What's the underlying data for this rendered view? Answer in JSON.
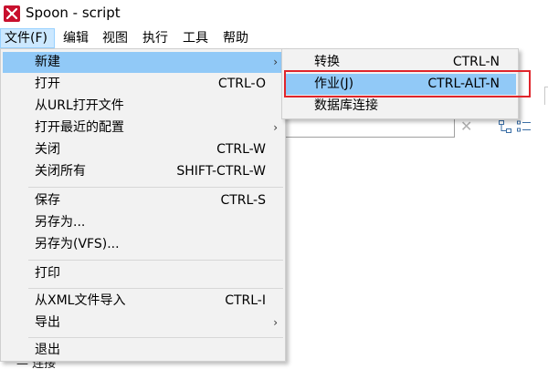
{
  "window": {
    "title": "Spoon - script"
  },
  "menubar": {
    "items": [
      {
        "label": "文件(F)",
        "active": true
      },
      {
        "label": "编辑"
      },
      {
        "label": "视图"
      },
      {
        "label": "执行"
      },
      {
        "label": "工具"
      },
      {
        "label": "帮助"
      }
    ]
  },
  "file_menu": {
    "items": [
      {
        "label": "新建",
        "shortcut": "",
        "submenu": true,
        "highlighted": true
      },
      {
        "label": "打开",
        "shortcut": "CTRL-O"
      },
      {
        "label": "从URL打开文件",
        "shortcut": ""
      },
      {
        "label": "打开最近的配置",
        "shortcut": "",
        "submenu": true
      },
      {
        "label": "关闭",
        "shortcut": "CTRL-W"
      },
      {
        "label": "关闭所有",
        "shortcut": "SHIFT-CTRL-W"
      },
      {
        "label": "保存",
        "shortcut": "CTRL-S"
      },
      {
        "label": "另存为...",
        "shortcut": ""
      },
      {
        "label": "另存为(VFS)...",
        "shortcut": ""
      },
      {
        "label": "打印",
        "shortcut": ""
      },
      {
        "label": "从XML文件导入",
        "shortcut": "CTRL-I"
      },
      {
        "label": "导出",
        "shortcut": "",
        "submenu": true
      },
      {
        "label": "退出",
        "shortcut": ""
      }
    ],
    "submenu_arrow": "›"
  },
  "new_submenu": {
    "items": [
      {
        "label": "转换",
        "shortcut": "CTRL-N"
      },
      {
        "label": "作业(J)",
        "shortcut": "CTRL-ALT-N",
        "highlighted": true
      },
      {
        "label": "数据库连接",
        "shortcut": ""
      }
    ]
  },
  "background": {
    "clear_glyph": "✕",
    "bottom_fragment": "— 连接"
  },
  "colors": {
    "highlight": "#91c9f7",
    "menubar_active": "#cce8ff",
    "annotation_box": "#e0252b",
    "app_icon": "#c8102e"
  }
}
